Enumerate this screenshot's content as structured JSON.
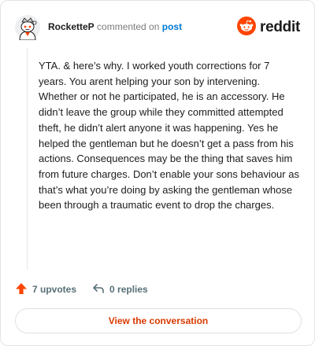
{
  "comment": {
    "username": "RocketteP",
    "action_text": "commented on",
    "post_link": "post",
    "body": "YTA. & here’s why. I worked youth corrections for 7 years. You arent helping your son by intervening. Whether or not he participated, he is an accessory. He didn’t leave the group while they committed attempted theft, he didn’t alert anyone it was happening. Yes he helped the gentleman but he doesn’t get a pass from his actions. Consequences may be the thing that saves him from future charges. Don’t enable your sons behaviour as that’s what you’re doing by asking the gentleman whose been through a traumatic event to drop the charges.",
    "upvotes": "7 upvotes",
    "replies": "0 replies",
    "view_button": "View the conversation"
  },
  "brand": {
    "name": "reddit",
    "icon": "reddit-logo-icon",
    "color": "#ff4500"
  },
  "icons": {
    "avatar": "snoo-avatar-icon",
    "upvote": "upvote-arrow-icon",
    "reply": "reply-arrow-icon"
  },
  "colors": {
    "accent": "#ff4500",
    "link": "#0079d3",
    "button_text": "#d93a00",
    "muted": "#576f76"
  }
}
